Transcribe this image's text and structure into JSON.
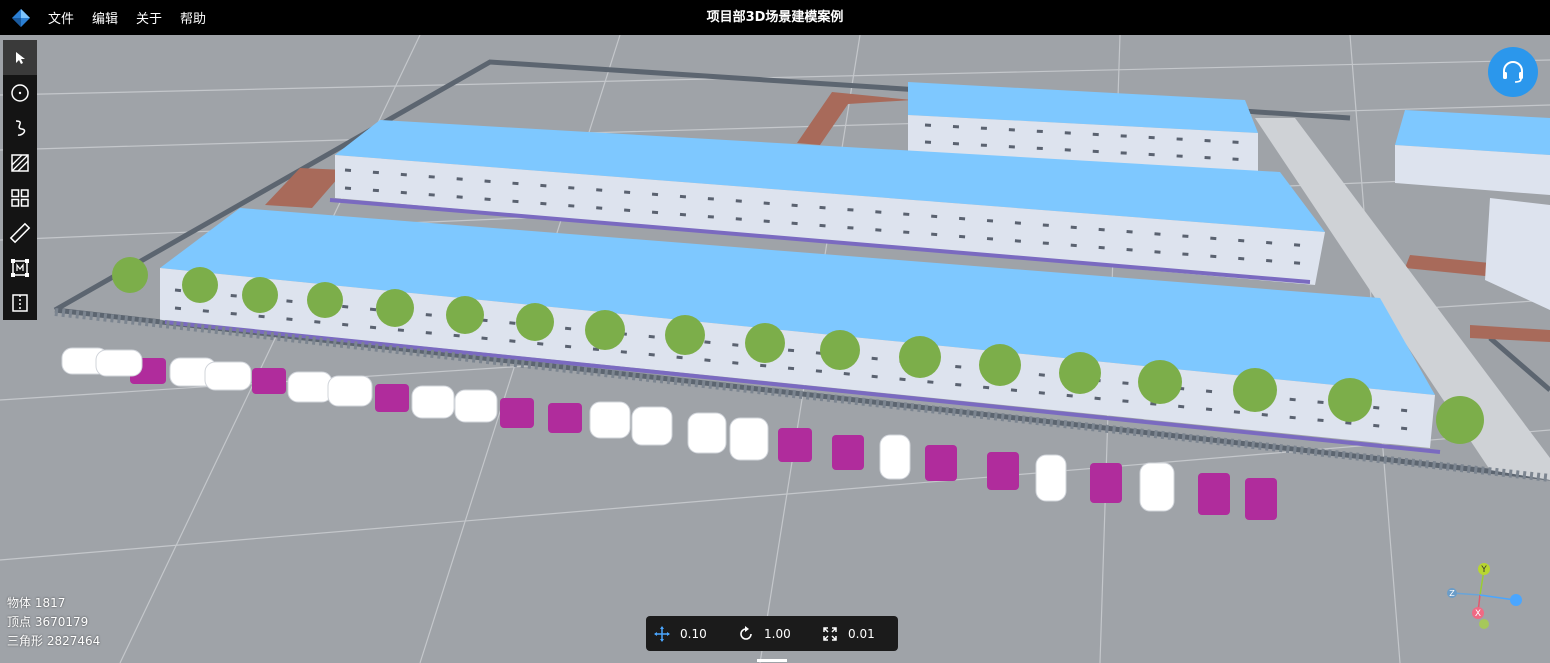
{
  "menubar": {
    "logo_icon": "app-logo-diamond",
    "items": [
      "文件",
      "编辑",
      "关于",
      "帮助"
    ],
    "title": "项目部3D场景建模案例"
  },
  "toolbar": {
    "tools": [
      {
        "name": "select-icon",
        "active": true
      },
      {
        "name": "circle-icon",
        "active": false
      },
      {
        "name": "curve-icon",
        "active": false
      },
      {
        "name": "area-hatch-icon",
        "active": false
      },
      {
        "name": "grid-icon",
        "active": false
      },
      {
        "name": "ruler-icon",
        "active": false
      },
      {
        "name": "measure-area-icon",
        "active": false
      },
      {
        "name": "split-view-icon",
        "active": false
      }
    ]
  },
  "stats": {
    "objects": "物体 1817",
    "vertices": "顶点 3670179",
    "triangles": "三角形 2827464"
  },
  "transform": {
    "move": "0.10",
    "rotate": "1.00",
    "scale": "0.01"
  },
  "gizmo": {
    "x": "X",
    "y": "Y",
    "z": "Z"
  },
  "colors": {
    "ground": "#9fa3a8",
    "roof": "#7ec8ff",
    "wall": "#dde3ee",
    "accent": "#2b97ec",
    "truck": "#b02c9c",
    "path": "#a86a5a"
  }
}
